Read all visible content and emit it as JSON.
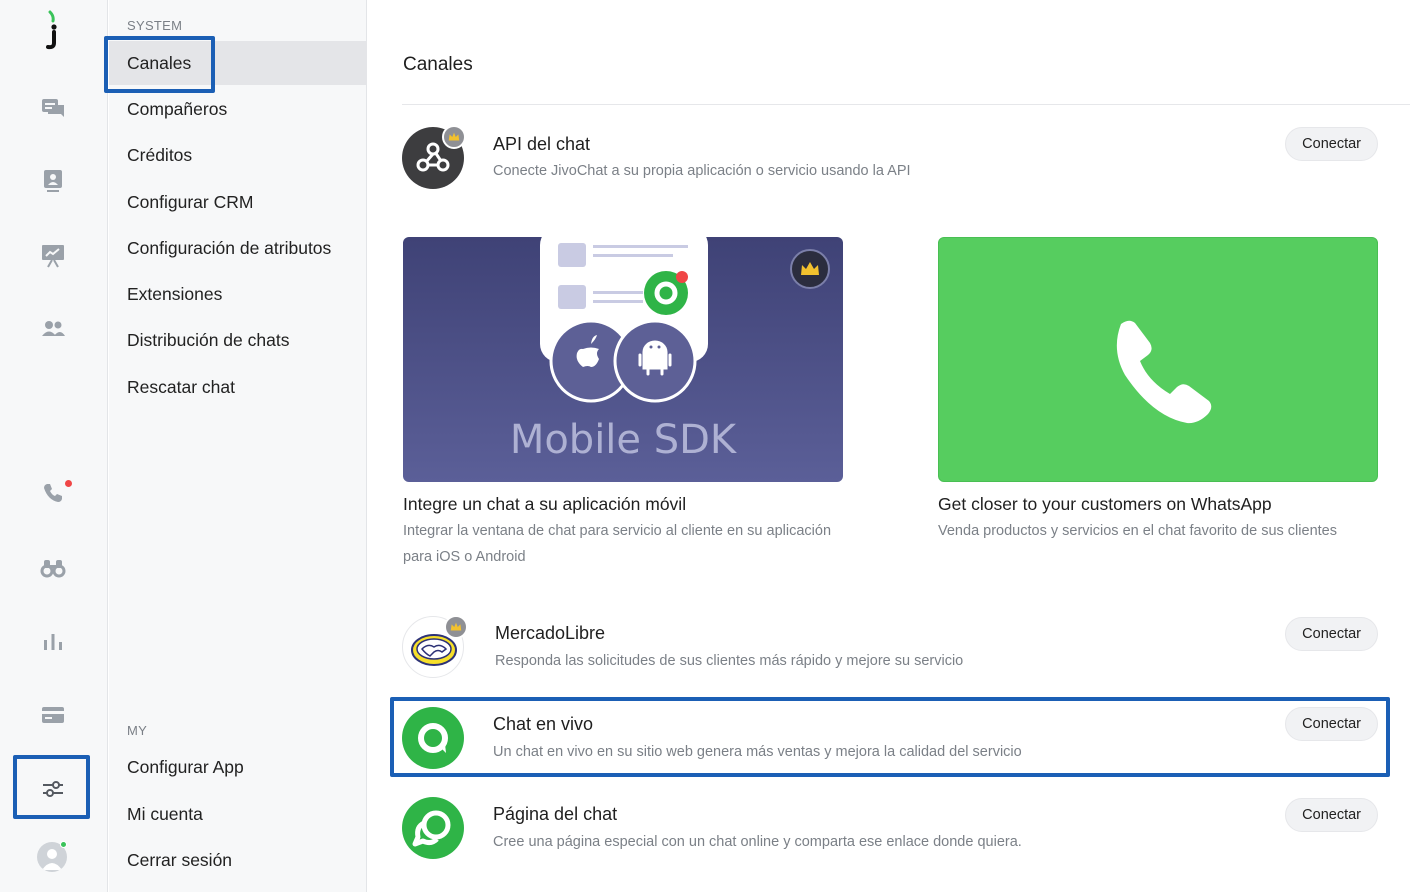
{
  "rail": {
    "icons": [
      "logo-icon",
      "chats-icon",
      "visitors-icon",
      "reports-icon",
      "team-icon",
      "phone-icon",
      "binoculars-icon",
      "stats-icon",
      "billing-icon",
      "settings-icon",
      "user-avatar-icon"
    ],
    "accent_color": "#1b5fb5"
  },
  "menu": {
    "system_label": "SYSTEM",
    "system_items": [
      "Canales",
      "Compañeros",
      "Créditos",
      "Configurar CRM",
      "Configuración de atributos",
      "Extensiones",
      "Distribución de chats",
      "Rescatar chat"
    ],
    "my_label": "MY",
    "my_items": [
      "Configurar App",
      "Mi cuenta",
      "Cerrar sesión"
    ],
    "active": "Canales"
  },
  "main": {
    "title": "Canales",
    "api": {
      "name": "API del chat",
      "desc": "Conecte JivoChat a su propia aplicación o servicio usando la API",
      "button": "Conectar"
    },
    "cards": [
      {
        "image_text": "Mobile SDK",
        "title": "Integre un chat a su aplicación móvil",
        "desc": "Integrar la ventana de chat para servicio al cliente en su aplicación para iOS o Android",
        "badge": "1"
      },
      {
        "title": "Get closer to your customers on WhatsApp",
        "desc": "Venda productos y servicios en el chat favorito de sus clientes"
      }
    ],
    "mercadolibre": {
      "name": "MercadoLibre",
      "desc": "Responda las solicitudes de sus clientes más rápido y mejore su servicio",
      "button": "Conectar"
    },
    "live_chat": {
      "name": "Chat en vivo",
      "desc": "Un chat en vivo en su sitio web genera más ventas y mejora la calidad del servicio",
      "button": "Conectar"
    },
    "chat_page": {
      "name": "Página del chat",
      "desc": "Cree una página especial con un chat online y comparta ese enlace donde quiera.",
      "button": "Conectar"
    },
    "colors": {
      "whatsapp_green": "#56cd5f",
      "sdk_purple": "#4a4e86",
      "jivo_green": "#2fb447"
    }
  }
}
